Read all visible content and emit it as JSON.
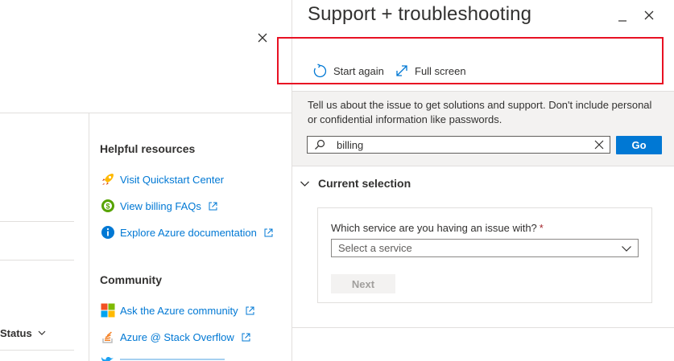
{
  "background_page": {
    "helpful_resources": {
      "heading": "Helpful resources",
      "links": [
        {
          "label": "Visit Quickstart Center",
          "icon": "rocket-icon",
          "external": false
        },
        {
          "label": "View billing FAQs",
          "icon": "billing-icon",
          "external": true
        },
        {
          "label": "Explore Azure documentation",
          "icon": "info-icon",
          "external": true
        }
      ]
    },
    "community": {
      "heading": "Community",
      "links": [
        {
          "label": "Ask the Azure community",
          "icon": "microsoft-logo-icon",
          "external": true
        },
        {
          "label": "Azure @ Stack Overflow",
          "icon": "stack-overflow-icon",
          "external": true
        }
      ]
    },
    "table": {
      "status_column": "Status"
    }
  },
  "blade": {
    "title": "Support + troubleshooting",
    "commands": {
      "start_again": "Start again",
      "full_screen": "Full screen"
    },
    "info_text": "Tell us about the issue to get solutions and support. Don't include personal or confidential information like passwords.",
    "search": {
      "value": "billing",
      "placeholder": ""
    },
    "go_label": "Go",
    "section": {
      "title": "Current selection",
      "service_question": "Which service are you having an issue with?",
      "required_mark": "*",
      "service_select_placeholder": "Select a service",
      "next_label": "Next"
    }
  },
  "colors": {
    "accent": "#0078d4",
    "highlight": "#e81123",
    "band": "#f3f2f1",
    "required": "#a4262c"
  }
}
